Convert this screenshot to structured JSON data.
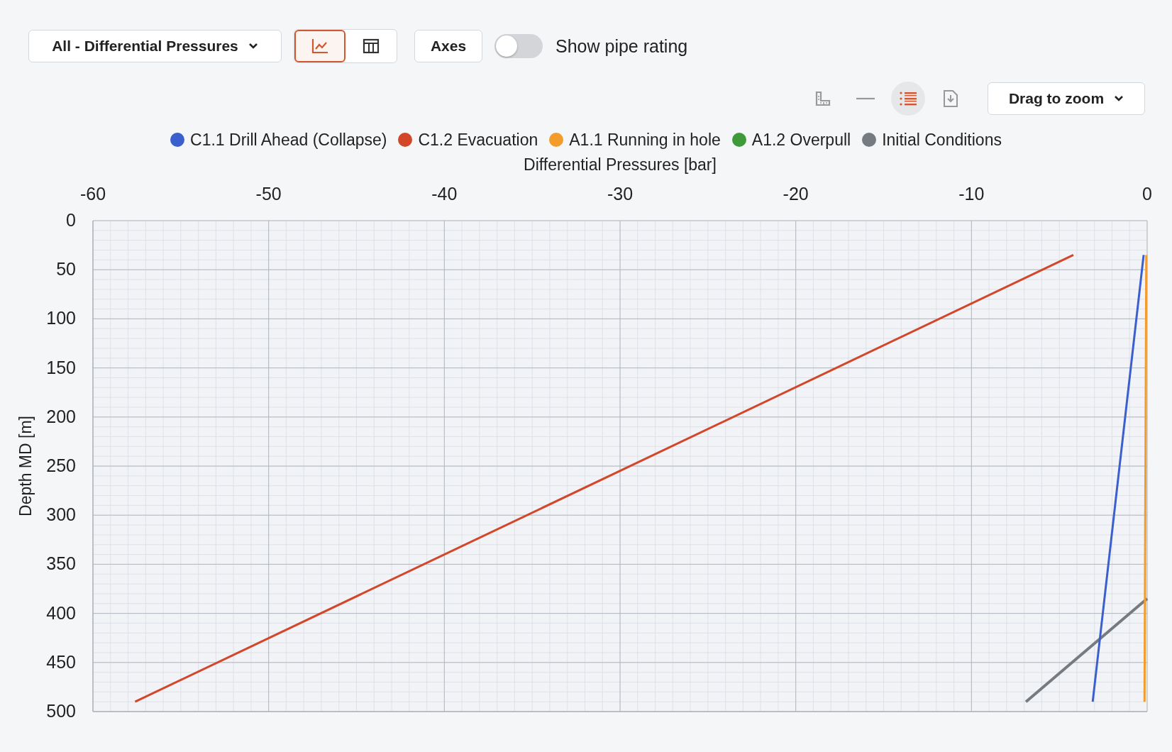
{
  "toolbar": {
    "dataset_dropdown": {
      "label": "All - Differential Pressures"
    },
    "view_buttons": [
      {
        "kind": "chart",
        "selected": true
      },
      {
        "kind": "table",
        "selected": false
      }
    ],
    "axes_button": {
      "label": "Axes"
    },
    "pipe_rating_toggle": {
      "label": "Show pipe rating",
      "on": false
    }
  },
  "chart_tools": [
    {
      "kind": "ruler",
      "selected": false
    },
    {
      "kind": "line",
      "selected": false
    },
    {
      "kind": "legend",
      "selected": true
    },
    {
      "kind": "export",
      "selected": false
    }
  ],
  "zoom_dropdown": {
    "label": "Drag to zoom"
  },
  "chart": {
    "chart_data": {
      "type": "line",
      "xlabel": "Differential Pressures [bar]",
      "ylabel": "Depth MD [m]",
      "xlim": [
        -60,
        0
      ],
      "ylim": [
        500,
        0
      ],
      "grid": true,
      "xticks": [
        -60,
        -50,
        -40,
        -30,
        -20,
        -10,
        0
      ],
      "yticks": [
        0,
        50,
        100,
        150,
        200,
        250,
        300,
        350,
        400,
        450,
        500
      ],
      "series": [
        {
          "name": "C1.1 Drill Ahead (Collapse)",
          "color": "#3b5fcc",
          "x": [
            -0.2,
            -3.1
          ],
          "values": [
            35,
            490
          ]
        },
        {
          "name": "C1.2 Evacuation",
          "color": "#d2462a",
          "x": [
            -4.2,
            -57.6
          ],
          "values": [
            35,
            490
          ]
        },
        {
          "name": "A1.1 Running in hole",
          "color": "#f39c2c",
          "x": [
            -0.05,
            -0.15
          ],
          "values": [
            35,
            490
          ]
        },
        {
          "name": "A1.2 Overpull",
          "color": "#3f9b3a",
          "x": [
            null,
            null
          ],
          "values": [
            null,
            null
          ]
        },
        {
          "name": "Initial Conditions",
          "color": "#767b82",
          "x": [
            0,
            -6.9
          ],
          "values": [
            385,
            490
          ]
        }
      ]
    }
  }
}
